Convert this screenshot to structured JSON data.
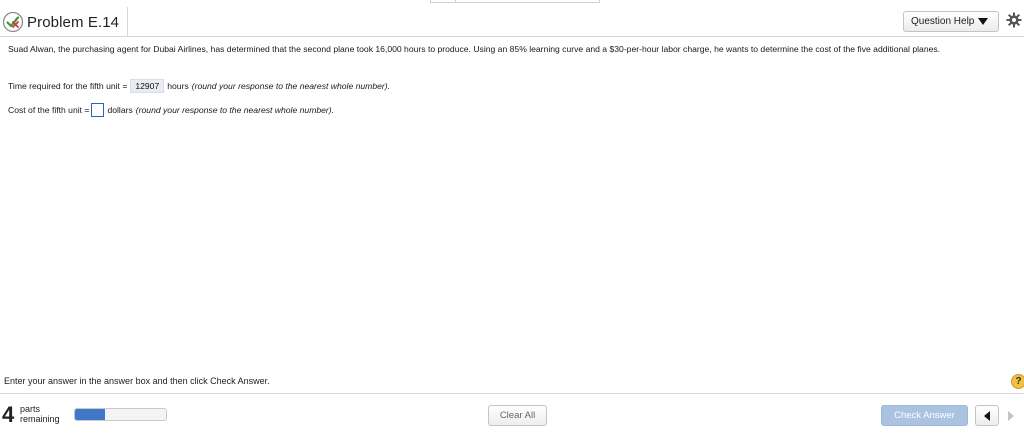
{
  "header": {
    "title": "Problem E.14",
    "status_icon": "partially-correct-icon",
    "question_help_label": "Question Help",
    "settings_icon": "gear-icon"
  },
  "problem": {
    "statement": "Suad Alwan, the purchasing agent for Dubai Airlines, has determined that the second plane took 16,000 hours to produce.  Using an 85% learning curve and a $30-per-hour labor charge, he wants to determine the cost of the five additional planes."
  },
  "part1": {
    "label": "Time required for the fifth unit =",
    "value": "12907",
    "unit": "hours",
    "hint": "(round your response to the nearest whole number)."
  },
  "part2": {
    "label": "Cost of the fifth unit =",
    "value": "",
    "unit": "dollars",
    "hint": "(round your response to the nearest whole number)."
  },
  "footer": {
    "instruction": "Enter your answer in the answer box and then click Check Answer.",
    "help_symbol": "?",
    "parts_count": "4",
    "parts_line1": "parts",
    "parts_line2": "remaining",
    "progress_fraction": 0.33,
    "clear_all_label": "Clear All",
    "check_answer_label": "Check Answer"
  },
  "colors": {
    "progress_fill": "#3f78c8",
    "check_button": "#a9c3e1",
    "input_border": "#2c62b8",
    "help_icon": "#f2c043"
  }
}
